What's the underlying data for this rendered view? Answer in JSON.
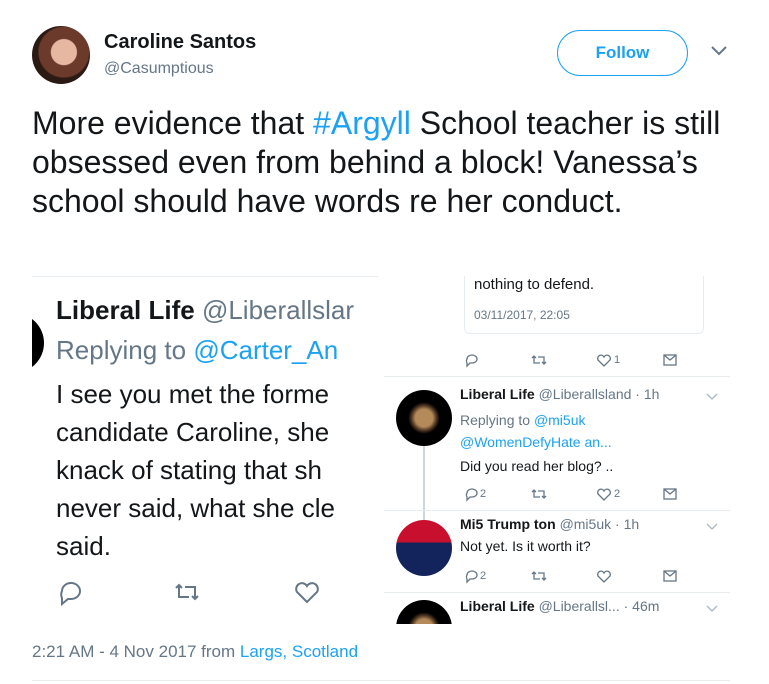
{
  "author": {
    "name": "Caroline Santos",
    "handle": "@Casumptious"
  },
  "follow_button": "Follow",
  "tweet": {
    "text_before": "More evidence that ",
    "hashtag": "#Argyll",
    "text_after": " School teacher is still obsessed even from behind a block! Vanessa’s school should have words re her conduct."
  },
  "left_screenshot": {
    "name": "Liberal Life",
    "handle": "@Liberallslar",
    "replying_prefix": "Replying to ",
    "replying_to": "@Carter_An",
    "body_lines": [
      "I see you met the forme",
      "candidate Caroline, she",
      "knack of stating that sh",
      "never said, what she cle",
      "said."
    ]
  },
  "right_screenshot": {
    "quote_text": "nothing to defend.",
    "quote_date": "03/11/2017, 22:05",
    "top_actions": {
      "like_count": "1"
    },
    "replies": [
      {
        "name": "Liberal Life",
        "handle": "@Liberallsland",
        "time": " · 1h",
        "replying_prefix": "Replying to ",
        "replying_to_1": "@mi5uk",
        "replying_to_2": "@WomenDefyHate an...",
        "text": "Did you read her blog? ..",
        "reply_count": "2",
        "like_count": "2"
      },
      {
        "name": "Mi5 Trump ton",
        "handle": "@mi5uk",
        "time": " · 1h",
        "text": "Not yet. Is it worth it?",
        "reply_count": "2"
      },
      {
        "name": "Liberal Life",
        "handle": "@Liberallsl...",
        "time": " · 46m"
      }
    ]
  },
  "footer": {
    "timestamp": "2:21 AM - 4 Nov 2017 from ",
    "location": "Largs, Scotland"
  },
  "colors": {
    "accent": "#1da1f2",
    "muted": "#657786",
    "text": "#14171a"
  }
}
